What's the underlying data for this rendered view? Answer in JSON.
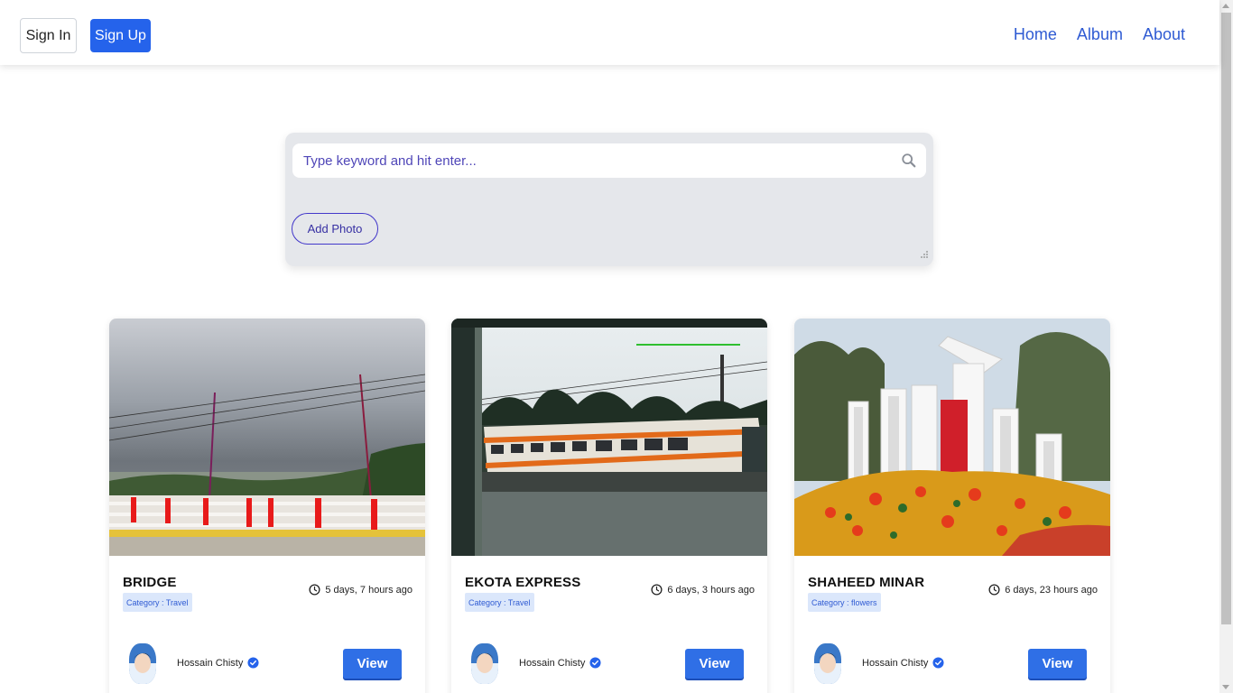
{
  "nav": {
    "signin_label": "Sign In",
    "signup_label": "Sign Up",
    "links": [
      "Home",
      "Album",
      "About"
    ]
  },
  "search": {
    "placeholder": "Type keyword and hit enter...",
    "add_photo_label": "Add Photo"
  },
  "cards": [
    {
      "title": "BRIDGE",
      "category": "Category : Travel",
      "time": "5 days, 7 hours ago",
      "author": "Hossain Chisty",
      "view_label": "View"
    },
    {
      "title": "EKOTA EXPRESS",
      "category": "Category : Travel",
      "time": "6 days, 3 hours ago",
      "author": "Hossain Chisty",
      "view_label": "View"
    },
    {
      "title": "SHAHEED MINAR",
      "category": "Category : flowers",
      "time": "6 days, 23 hours ago",
      "author": "Hossain Chisty",
      "view_label": "View"
    }
  ],
  "colors": {
    "primary": "#2563eb",
    "nav_link": "#2f5bd3",
    "panel_bg": "#e5e7eb",
    "category_bg": "#dbe7fb",
    "outline_purple": "#4338ca"
  }
}
